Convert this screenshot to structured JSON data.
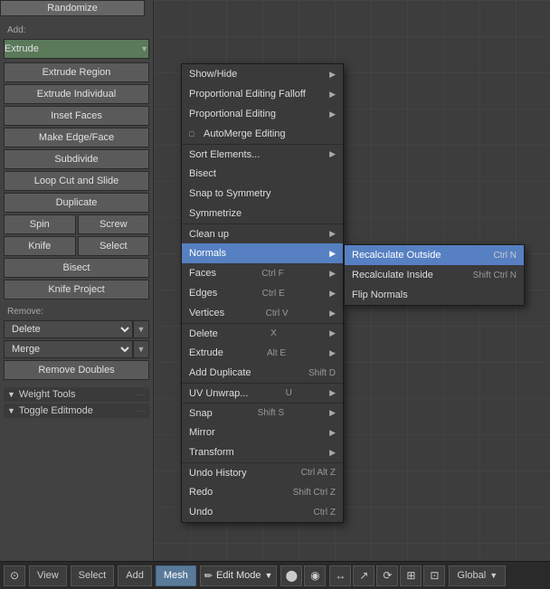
{
  "leftPanel": {
    "randomize_label": "Randomize",
    "add_label": "Add:",
    "extrude_label": "Extrude",
    "extrude_region_label": "Extrude Region",
    "extrude_individual_label": "Extrude Individual",
    "inset_faces_label": "Inset Faces",
    "make_edge_face_label": "Make Edge/Face",
    "subdivide_label": "Subdivide",
    "loop_cut_label": "Loop Cut and Slide",
    "duplicate_label": "Duplicate",
    "spin_label": "Spin",
    "screw_label": "Screw",
    "knife_label": "Knife",
    "select_label": "Select",
    "bisect_label": "Bisect",
    "knife_project_label": "Knife Project",
    "remove_label": "Remove:",
    "delete_label": "Delete",
    "merge_label": "Merge",
    "remove_doubles_label": "Remove Doubles",
    "weight_tools_label": "▼ Weight Tools",
    "weight_tools_dots": "...",
    "toggle_editmode_label": "▼ Toggle Editmode",
    "toggle_editmode_dots": "..."
  },
  "contextMenu": {
    "items": [
      {
        "label": "Show/Hide",
        "shortcut": "",
        "arrow": "▶",
        "check": "",
        "separator": false
      },
      {
        "label": "Proportional Editing Falloff",
        "shortcut": "",
        "arrow": "▶",
        "check": "",
        "separator": false
      },
      {
        "label": "Proportional Editing",
        "shortcut": "",
        "arrow": "▶",
        "check": "",
        "separator": false
      },
      {
        "label": "AutoMerge Editing",
        "shortcut": "",
        "arrow": "",
        "check": "□",
        "separator": false
      },
      {
        "label": "Sort Elements...",
        "shortcut": "",
        "arrow": "▶",
        "check": "",
        "separator": true
      },
      {
        "label": "Bisect",
        "shortcut": "",
        "arrow": "",
        "check": "",
        "separator": false
      },
      {
        "label": "Snap to Symmetry",
        "shortcut": "",
        "arrow": "",
        "check": "",
        "separator": false
      },
      {
        "label": "Symmetrize",
        "shortcut": "",
        "arrow": "",
        "check": "",
        "separator": false
      },
      {
        "label": "Clean up",
        "shortcut": "",
        "arrow": "▶",
        "check": "",
        "separator": true
      },
      {
        "label": "Normals",
        "shortcut": "",
        "arrow": "▶",
        "check": "",
        "separator": false,
        "active": true
      },
      {
        "label": "Faces",
        "shortcut": "Ctrl F",
        "arrow": "▶",
        "check": "",
        "separator": false
      },
      {
        "label": "Edges",
        "shortcut": "Ctrl E",
        "arrow": "▶",
        "check": "",
        "separator": false
      },
      {
        "label": "Vertices",
        "shortcut": "Ctrl V",
        "arrow": "▶",
        "check": "",
        "separator": false
      },
      {
        "label": "Delete",
        "shortcut": "X",
        "arrow": "▶",
        "check": "",
        "separator": true
      },
      {
        "label": "Extrude",
        "shortcut": "Alt E",
        "arrow": "▶",
        "check": "",
        "separator": false
      },
      {
        "label": "Add Duplicate",
        "shortcut": "Shift D",
        "arrow": "",
        "check": "",
        "separator": false
      },
      {
        "label": "UV Unwrap...",
        "shortcut": "U",
        "arrow": "▶",
        "check": "",
        "separator": true
      },
      {
        "label": "Snap",
        "shortcut": "Shift S",
        "arrow": "▶",
        "check": "",
        "separator": true
      },
      {
        "label": "Mirror",
        "shortcut": "",
        "arrow": "▶",
        "check": "",
        "separator": false
      },
      {
        "label": "Transform",
        "shortcut": "",
        "arrow": "▶",
        "check": "",
        "separator": false
      },
      {
        "label": "Undo History",
        "shortcut": "Ctrl Alt Z",
        "arrow": "",
        "check": "",
        "separator": true
      },
      {
        "label": "Redo",
        "shortcut": "Shift Ctrl Z",
        "arrow": "",
        "check": "",
        "separator": false
      },
      {
        "label": "Undo",
        "shortcut": "Ctrl Z",
        "arrow": "",
        "check": "",
        "separator": false
      }
    ]
  },
  "normalsSubmenu": {
    "items": [
      {
        "label": "Recalculate Outside",
        "shortcut": "Ctrl N",
        "active": true
      },
      {
        "label": "Recalculate Inside",
        "shortcut": "Shift Ctrl N",
        "active": false
      },
      {
        "label": "Flip Normals",
        "shortcut": "",
        "active": false
      }
    ]
  },
  "statusBar": {
    "view_label": "View",
    "select_label": "Select",
    "add_label": "Add",
    "mesh_label": "Mesh",
    "edit_mode_label": "Edit Mode",
    "global_label": "Global"
  }
}
